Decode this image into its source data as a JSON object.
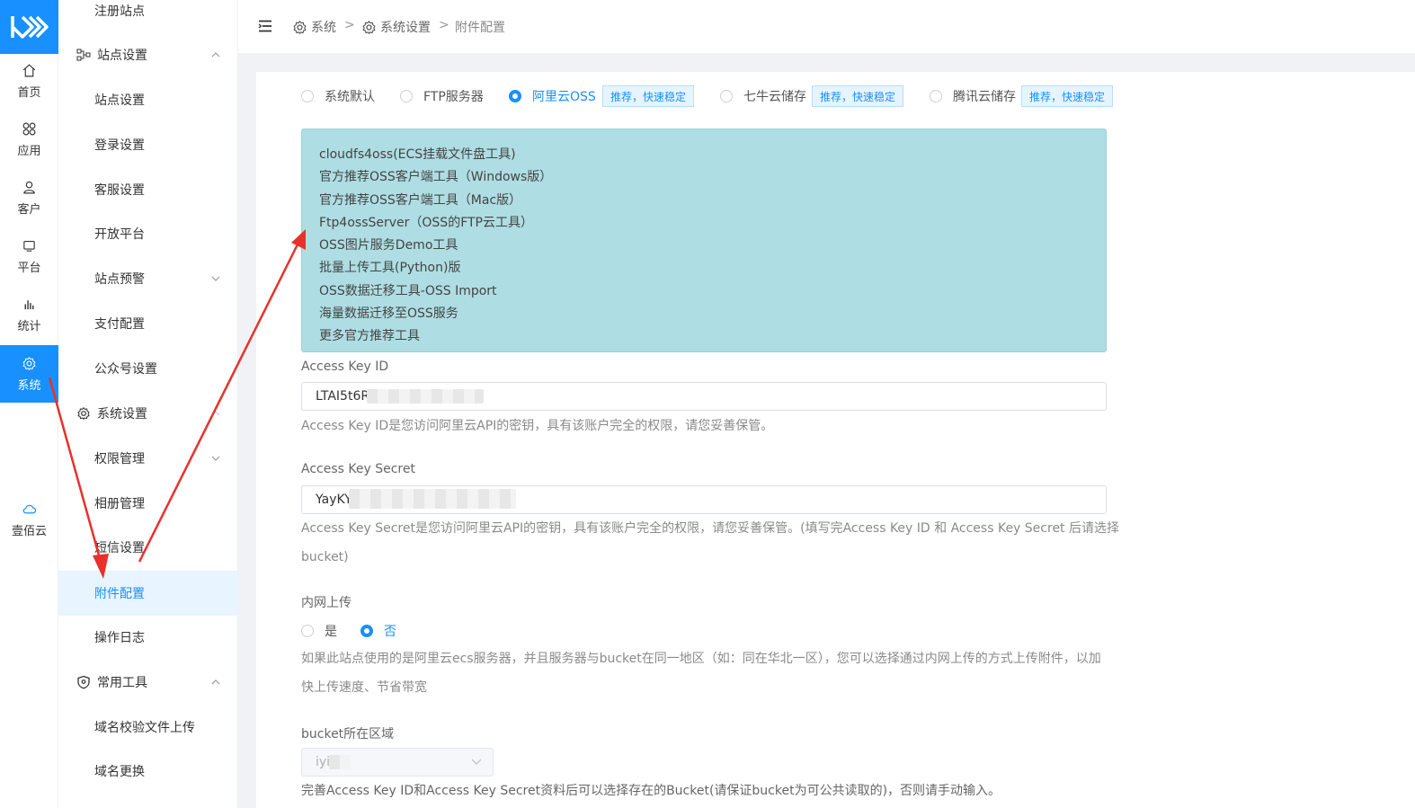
{
  "rail": {
    "items": [
      {
        "label": "首页",
        "icon": "home-icon"
      },
      {
        "label": "应用",
        "icon": "apps-icon"
      },
      {
        "label": "客户",
        "icon": "user-icon"
      },
      {
        "label": "平台",
        "icon": "platform-icon"
      },
      {
        "label": "统计",
        "icon": "chart-icon"
      },
      {
        "label": "系统",
        "icon": "gear-icon",
        "active": true
      },
      {
        "label": "壹佰云",
        "icon": "cloud-icon"
      }
    ]
  },
  "submenu": {
    "register": "注册站点",
    "site_group": "站点设置",
    "site_settings": "站点设置",
    "login_settings": "登录设置",
    "service_settings": "客服设置",
    "open_platform": "开放平台",
    "site_alert": "站点预警",
    "payment": "支付配置",
    "wechat": "公众号设置",
    "system_group": "系统设置",
    "permission": "权限管理",
    "album": "相册管理",
    "sms": "短信设置",
    "attachment": "附件配置",
    "logs": "操作日志",
    "tools_group": "常用工具",
    "domain_verify": "域名校验文件上传",
    "domain_change": "域名更换"
  },
  "breadcrumb": [
    "系统",
    "系统设置",
    "附件配置"
  ],
  "breadcrumb_sep": ">",
  "storage_options": {
    "default": "系统默认",
    "ftp": "FTP服务器",
    "aliyun": "阿里云OSS",
    "qiniu": "七牛云储存",
    "tencent": "腾讯云储存",
    "tag": "推荐，快速稳定",
    "selected": "aliyun"
  },
  "tools": [
    "cloudfs4oss(ECS挂载文件盘工具)",
    "官方推荐OSS客户端工具（Windows版）",
    "官方推荐OSS客户端工具（Mac版）",
    "Ftp4ossServer（OSS的FTP云工具）",
    "OSS图片服务Demo工具",
    "批量上传工具(Python)版",
    "OSS数据迁移工具-OSS Import",
    "海量数据迁移至OSS服务",
    "更多官方推荐工具"
  ],
  "form": {
    "key_id_label": "Access Key ID",
    "key_id_value": "LTAI5t6R",
    "key_id_help": "Access Key ID是您访问阿里云API的密钥，具有该账户完全的权限，请您妥善保管。",
    "key_secret_label": "Access Key Secret",
    "key_secret_value": "YayKY",
    "key_secret_help": "Access Key Secret是您访问阿里云API的密钥，具有该账户完全的权限，请您妥善保管。(填写完Access Key ID 和 Access Key Secret 后请选择",
    "key_secret_help2": "bucket)",
    "intranet_label": "内网上传",
    "intranet_yes": "是",
    "intranet_no": "否",
    "intranet_selected": "no",
    "intranet_help": "如果此站点使用的是阿里云ecs服务器，并且服务器与bucket在同一地区（如：同在华北一区），您可以选择通过内网上传的方式上传附件，以加",
    "intranet_help2": "快上传速度、节省带宽",
    "bucket_label": "bucket所在区域",
    "bucket_value": "iyi",
    "bucket_help": "完善Access Key ID和Access Key Secret资料后可以选择存在的Bucket(请保证bucket为可公共读取的)，否则请手动输入。"
  },
  "colors": {
    "accent": "#1890ff",
    "annotation": "#e8312a",
    "tools_bg": "#aedde3"
  }
}
